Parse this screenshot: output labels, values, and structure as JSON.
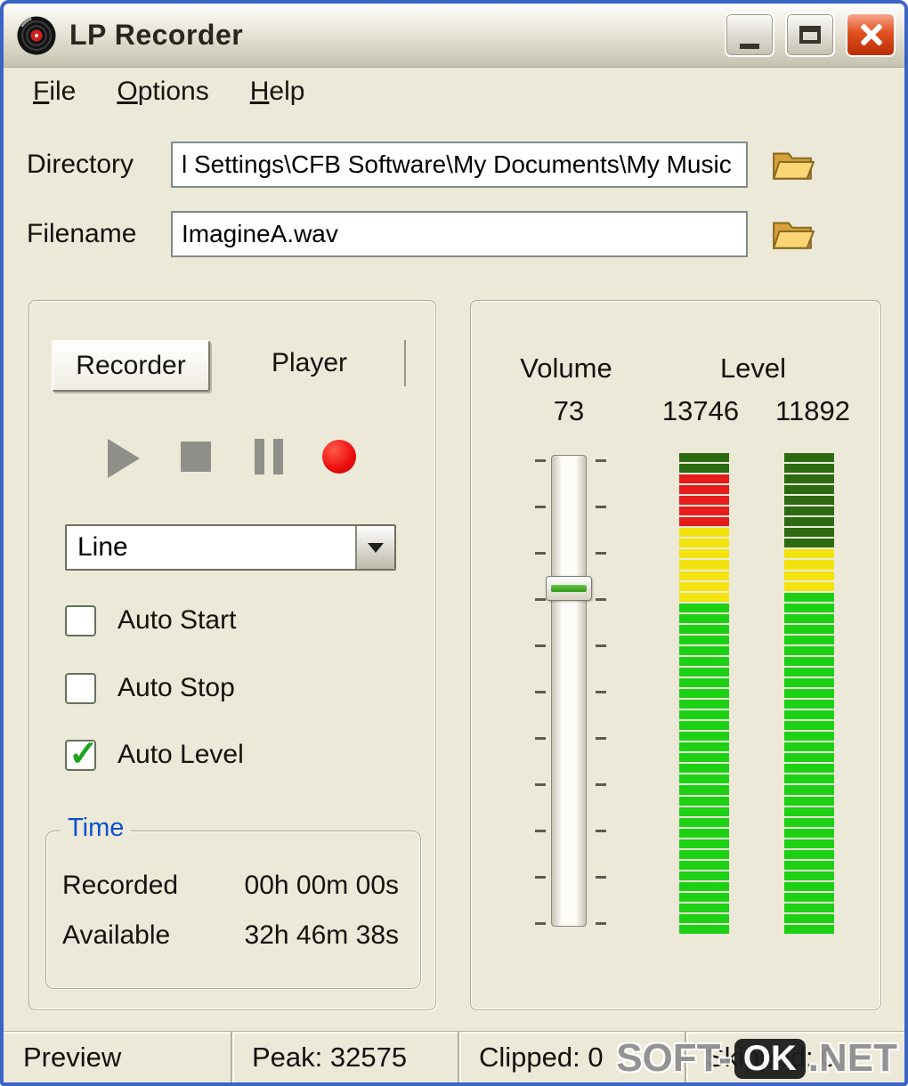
{
  "window": {
    "title": "LP Recorder"
  },
  "menu": {
    "items": [
      {
        "mnemonic": "F",
        "rest": "ile"
      },
      {
        "mnemonic": "O",
        "rest": "ptions"
      },
      {
        "mnemonic": "H",
        "rest": "elp"
      }
    ]
  },
  "fields": {
    "directory_label": "Directory",
    "directory_value": "l Settings\\CFB Software\\My Documents\\My Music",
    "filename_label": "Filename",
    "filename_value": "ImagineA.wav"
  },
  "recorder_panel": {
    "tab_recorder": "Recorder",
    "tab_player": "Player",
    "input_source": "Line",
    "auto_start": {
      "label": "Auto Start",
      "checked": false
    },
    "auto_stop": {
      "label": "Auto Stop",
      "checked": false
    },
    "auto_level": {
      "label": "Auto Level",
      "checked": true
    },
    "time_group": {
      "title": "Time",
      "recorded_label": "Recorded",
      "recorded_value": "00h 00m 00s",
      "available_label": "Available",
      "available_value": "32h 46m 38s"
    }
  },
  "meter_panel": {
    "volume_label": "Volume",
    "level_label": "Level",
    "volume_value": "73",
    "left_level_value": "13746",
    "right_level_value": "11892",
    "slider": {
      "value": 73,
      "min": 0,
      "max": 100
    },
    "meter_colors": {
      "dark": "#2d6b12",
      "red": "#e61c1c",
      "yellow": "#f2e30e",
      "green": "#1cd114"
    },
    "meters": [
      {
        "name": "left-meter",
        "segments": [
          [
            "dark",
            2
          ],
          [
            "red",
            5
          ],
          [
            "yellow",
            7
          ],
          [
            "green",
            31
          ]
        ]
      },
      {
        "name": "right-meter",
        "segments": [
          [
            "dark",
            9
          ],
          [
            "yellow",
            4
          ],
          [
            "green",
            32
          ]
        ]
      }
    ]
  },
  "status_bar": {
    "cells": [
      {
        "text": "Preview"
      },
      {
        "text": "Peak: 32575"
      },
      {
        "text": "Clipped: 0"
      },
      {
        "text": "Skipped: 0"
      }
    ]
  },
  "watermark": {
    "left": "SOFT-",
    "badge": "OK",
    "right": ".NET"
  }
}
